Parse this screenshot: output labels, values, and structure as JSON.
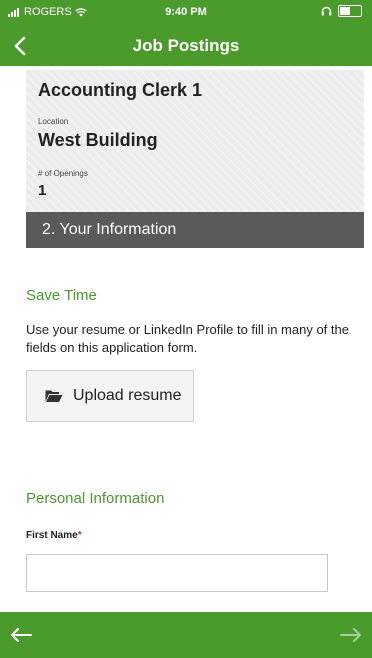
{
  "status_bar": {
    "carrier": "ROGERS",
    "time": "9:40 PM"
  },
  "nav": {
    "title": "Job Postings",
    "back_icon": "chevron-left-icon"
  },
  "job": {
    "title": "Accounting Clerk 1",
    "location_label": "Location",
    "location_value": "West Building",
    "openings_label": "# of Openings",
    "openings_value": "1"
  },
  "step": {
    "label": "2. Your Information"
  },
  "save_time": {
    "heading": "Save Time",
    "description": "Use your resume or LinkedIn Profile to fill in many of the fields on this application form.",
    "upload_label": "Upload resume",
    "upload_icon": "folder-open-icon"
  },
  "personal": {
    "heading": "Personal Information",
    "first_name_label": "First Name",
    "required_mark": "*",
    "first_name_value": ""
  },
  "footer": {
    "prev_icon": "arrow-left-icon",
    "next_icon": "arrow-right-icon"
  },
  "colors": {
    "brand_green": "#4a9a2c",
    "banner_gray": "#5a5a5a",
    "required_red": "#c0392b"
  }
}
